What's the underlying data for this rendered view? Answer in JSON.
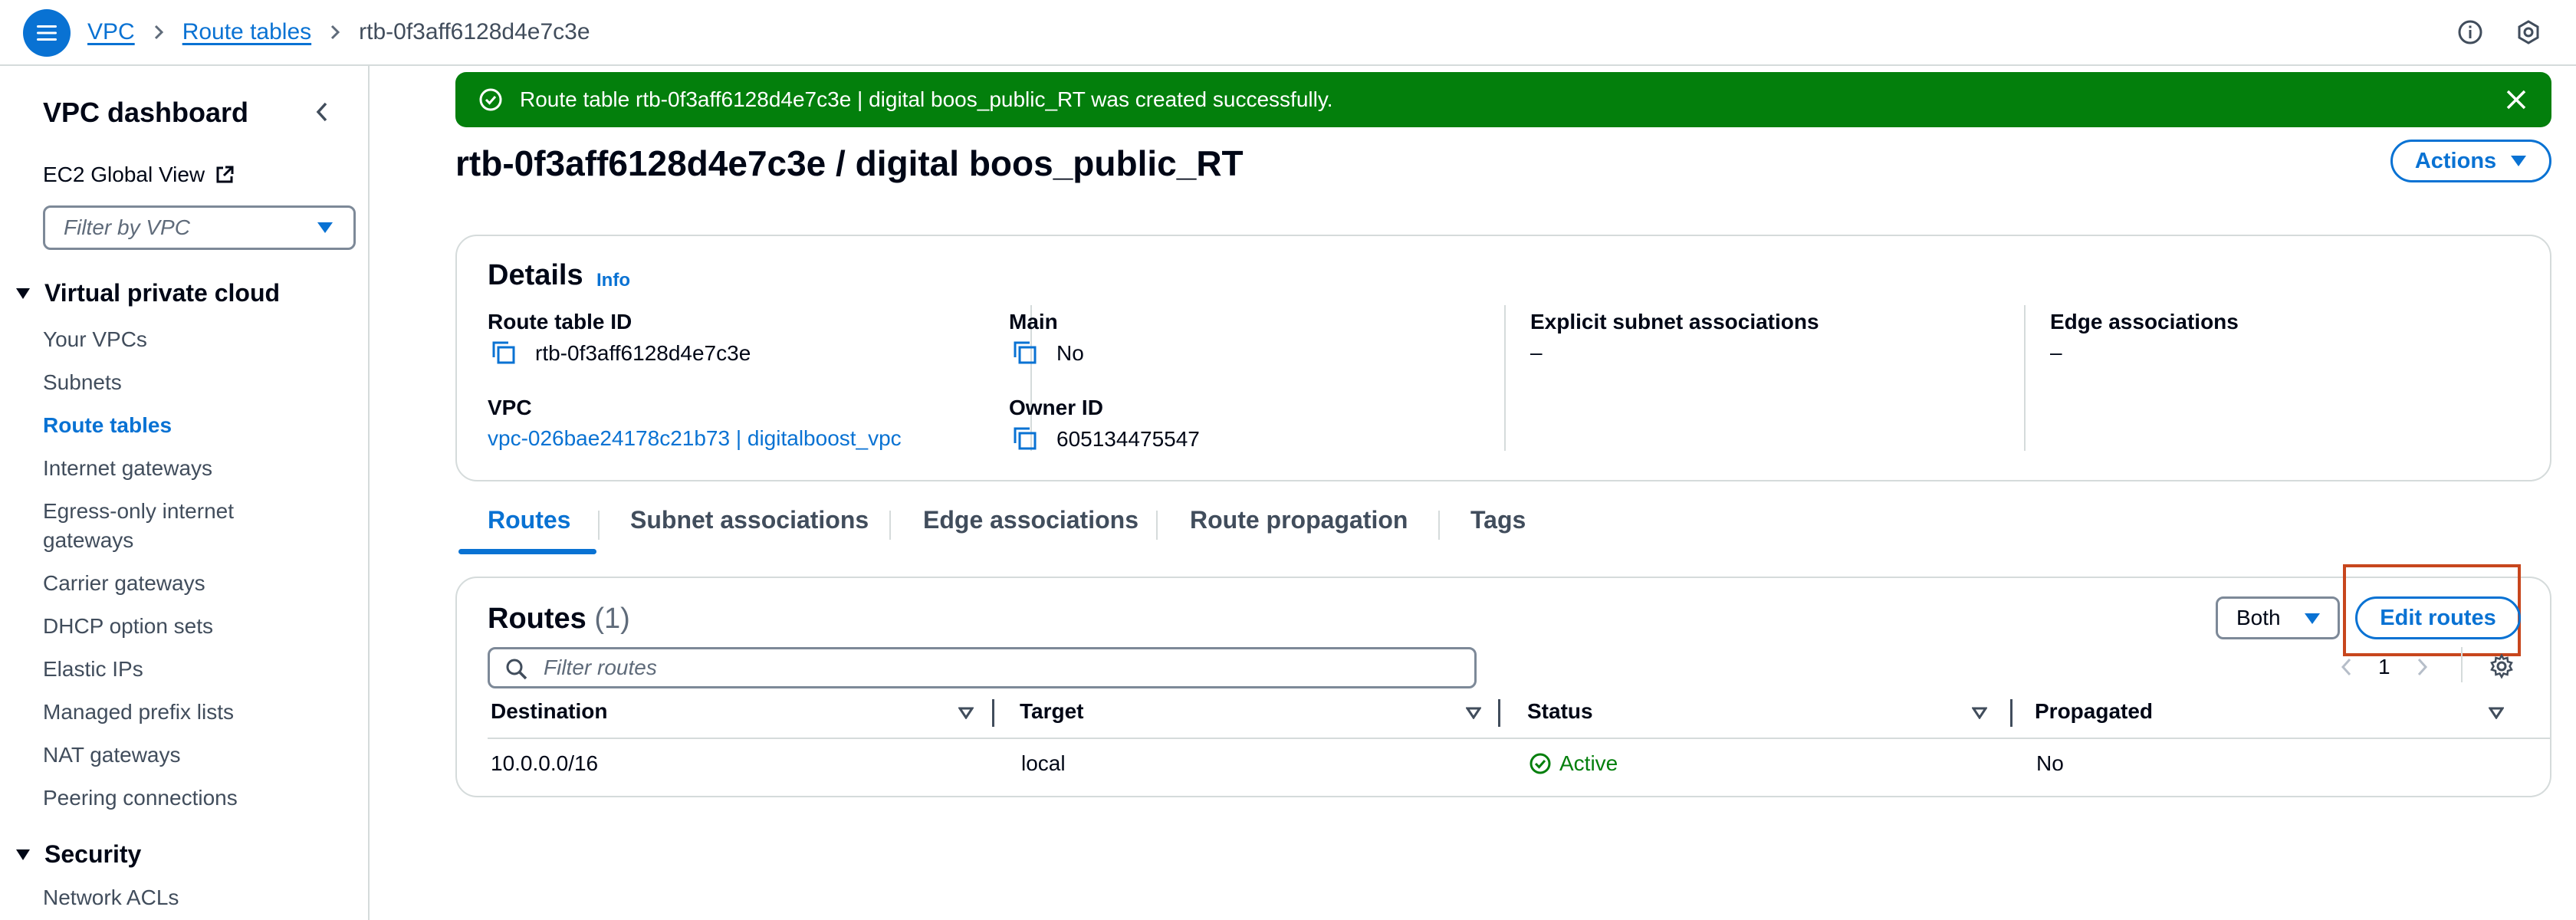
{
  "breadcrumbs": [
    "VPC",
    "Route tables",
    "rtb-0f3aff6128d4e7c3e"
  ],
  "sidebar": {
    "title": "VPC dashboard",
    "ec2_link": "EC2 Global View",
    "filter_placeholder": "Filter by VPC",
    "sections": [
      {
        "title": "Virtual private cloud",
        "items": [
          {
            "label": "Your VPCs",
            "active": false
          },
          {
            "label": "Subnets",
            "active": false
          },
          {
            "label": "Route tables",
            "active": true
          },
          {
            "label": "Internet gateways",
            "active": false
          },
          {
            "label": "Egress-only internet gateways",
            "active": false
          },
          {
            "label": "Carrier gateways",
            "active": false
          },
          {
            "label": "DHCP option sets",
            "active": false
          },
          {
            "label": "Elastic IPs",
            "active": false
          },
          {
            "label": "Managed prefix lists",
            "active": false
          },
          {
            "label": "NAT gateways",
            "active": false
          },
          {
            "label": "Peering connections",
            "active": false
          }
        ]
      },
      {
        "title": "Security",
        "items": [
          {
            "label": "Network ACLs",
            "active": false
          }
        ]
      }
    ]
  },
  "flash": {
    "message": "Route table rtb-0f3aff6128d4e7c3e | digital boos_public_RT was created successfully.",
    "type": "success"
  },
  "page": {
    "title": "rtb-0f3aff6128d4e7c3e / digital boos_public_RT",
    "actions_label": "Actions"
  },
  "details": {
    "title": "Details",
    "info": "Info",
    "route_table_id_label": "Route table ID",
    "route_table_id": "rtb-0f3aff6128d4e7c3e",
    "main_label": "Main",
    "main": "No",
    "explicit_label": "Explicit subnet associations",
    "explicit": "–",
    "edge_label": "Edge associations",
    "edge": "–",
    "vpc_label": "VPC",
    "vpc": "vpc-026bae24178c21b73 | digitalboost_vpc",
    "owner_label": "Owner ID",
    "owner": "605134475547"
  },
  "tabs": [
    "Routes",
    "Subnet associations",
    "Edge associations",
    "Route propagation",
    "Tags"
  ],
  "active_tab": "Routes",
  "routes": {
    "title": "Routes",
    "count": "(1)",
    "filter_value": "Both",
    "edit_label": "Edit routes",
    "filter_placeholder": "Filter routes",
    "page": "1",
    "columns": [
      "Destination",
      "Target",
      "Status",
      "Propagated"
    ],
    "rows": [
      {
        "destination": "10.0.0.0/16",
        "target": "local",
        "status": "Active",
        "propagated": "No"
      }
    ]
  },
  "colors": {
    "accent": "#0972d3",
    "success": "#037f0c",
    "highlight": "#c7461d"
  }
}
